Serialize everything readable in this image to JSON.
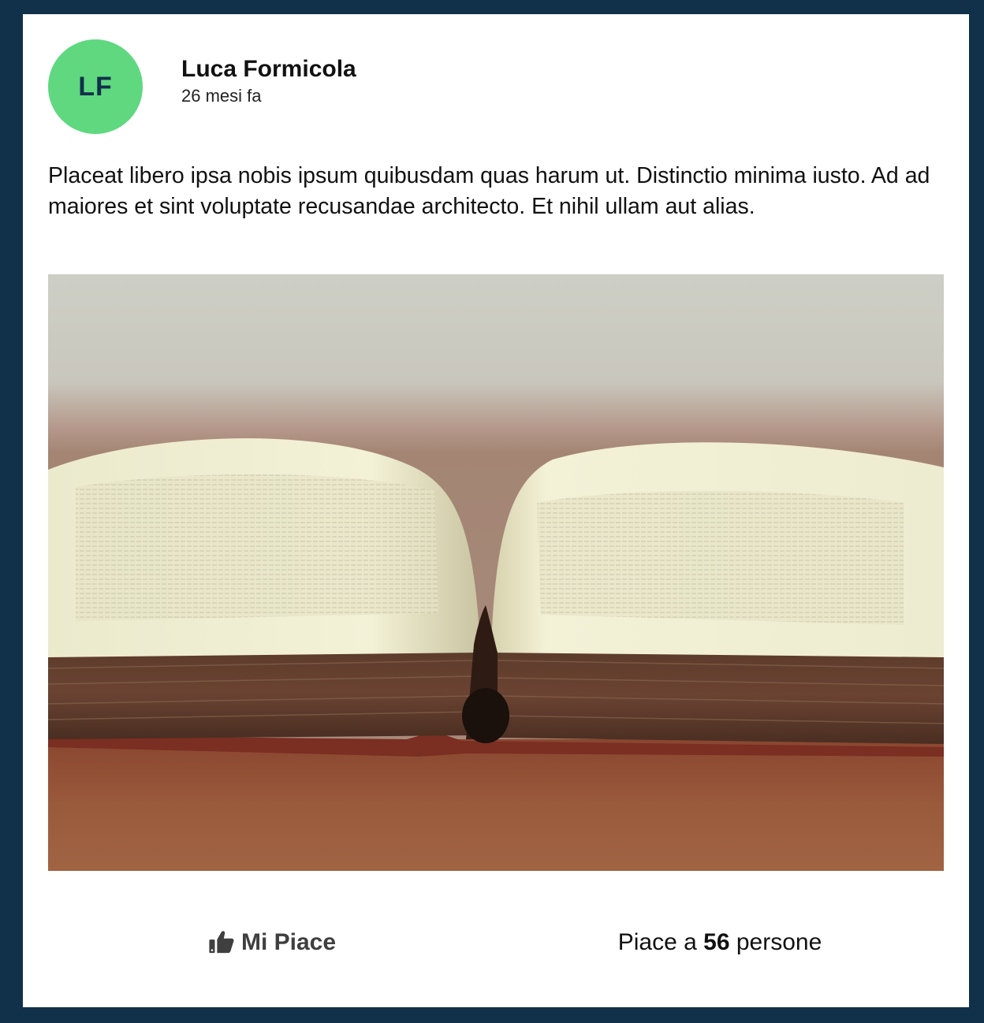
{
  "post": {
    "author": {
      "initials": "LF",
      "name": "Luca Formicola",
      "avatar_color": "#5fd880"
    },
    "time": "26 mesi fa",
    "text": "Placeat libero ipsa nobis ipsum quibusdam quas harum ut. Distinctio minima iusto. Ad ad maiores et sint voluptate recusandae architecto. Et nihil ullam aut alias.",
    "image": {
      "subject": "open-book-photo"
    },
    "footer": {
      "like_icon": "thumbs-up-icon",
      "like_label": "Mi Piace",
      "likes_prefix": "Piace a",
      "likes_count": "56",
      "likes_suffix": "persone"
    }
  },
  "colors": {
    "page_background": "#11304a",
    "card_background": "#ffffff",
    "avatar": "#5fd880",
    "avatar_text": "#11304a"
  }
}
